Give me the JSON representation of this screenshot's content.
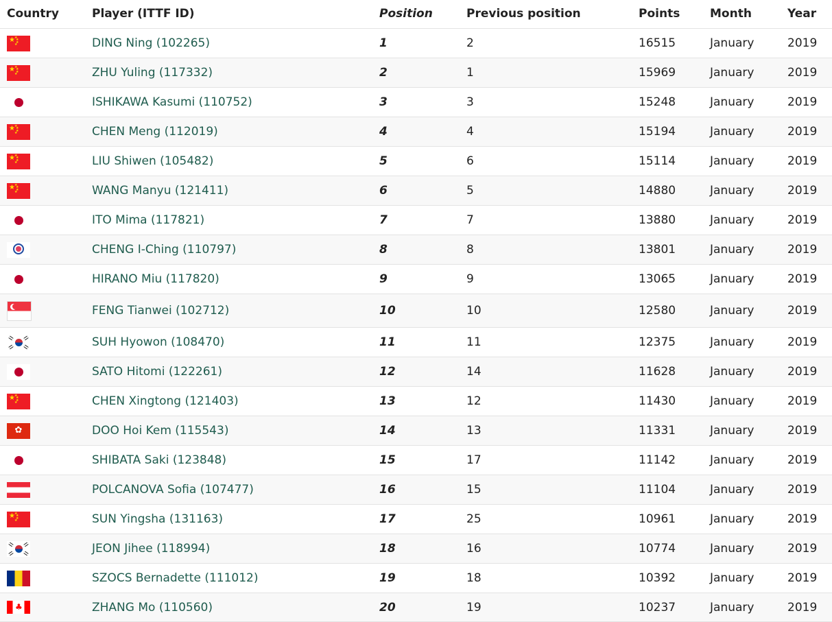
{
  "header": {
    "country": "Country",
    "player": "Player (ITTF ID)",
    "position": "Position",
    "previous_position": "Previous position",
    "points": "Points",
    "month": "Month",
    "year": "Year"
  },
  "colors": {
    "link": "#1f5c4e",
    "row_alt": "#f8f8f8",
    "border": "#e3e3e3"
  },
  "rows": [
    {
      "flag": "china-flag-icon",
      "player": "DING Ning (102265)",
      "position": "1",
      "previous": "2",
      "points": "16515",
      "month": "January",
      "year": "2019"
    },
    {
      "flag": "china-flag-icon",
      "player": "ZHU Yuling (117332)",
      "position": "2",
      "previous": "1",
      "points": "15969",
      "month": "January",
      "year": "2019"
    },
    {
      "flag": "japan-flag-icon",
      "player": "ISHIKAWA Kasumi (110752)",
      "position": "3",
      "previous": "3",
      "points": "15248",
      "month": "January",
      "year": "2019"
    },
    {
      "flag": "china-flag-icon",
      "player": "CHEN Meng (112019)",
      "position": "4",
      "previous": "4",
      "points": "15194",
      "month": "January",
      "year": "2019"
    },
    {
      "flag": "china-flag-icon",
      "player": "LIU Shiwen (105482)",
      "position": "5",
      "previous": "6",
      "points": "15114",
      "month": "January",
      "year": "2019"
    },
    {
      "flag": "china-flag-icon",
      "player": "WANG Manyu (121411)",
      "position": "6",
      "previous": "5",
      "points": "14880",
      "month": "January",
      "year": "2019"
    },
    {
      "flag": "japan-flag-icon",
      "player": "ITO Mima (117821)",
      "position": "7",
      "previous": "7",
      "points": "13880",
      "month": "January",
      "year": "2019"
    },
    {
      "flag": "chinese-taipei-flag-icon",
      "player": "CHENG I-Ching (110797)",
      "position": "8",
      "previous": "8",
      "points": "13801",
      "month": "January",
      "year": "2019"
    },
    {
      "flag": "japan-flag-icon",
      "player": "HIRANO Miu (117820)",
      "position": "9",
      "previous": "9",
      "points": "13065",
      "month": "January",
      "year": "2019"
    },
    {
      "flag": "singapore-flag-icon",
      "player": "FENG Tianwei (102712)",
      "position": "10",
      "previous": "10",
      "points": "12580",
      "month": "January",
      "year": "2019"
    },
    {
      "flag": "korea-flag-icon",
      "player": "SUH Hyowon (108470)",
      "position": "11",
      "previous": "11",
      "points": "12375",
      "month": "January",
      "year": "2019"
    },
    {
      "flag": "japan-flag-icon",
      "player": "SATO Hitomi (122261)",
      "position": "12",
      "previous": "14",
      "points": "11628",
      "month": "January",
      "year": "2019"
    },
    {
      "flag": "china-flag-icon",
      "player": "CHEN Xingtong (121403)",
      "position": "13",
      "previous": "12",
      "points": "11430",
      "month": "January",
      "year": "2019"
    },
    {
      "flag": "hong-kong-flag-icon",
      "player": "DOO Hoi Kem (115543)",
      "position": "14",
      "previous": "13",
      "points": "11331",
      "month": "January",
      "year": "2019"
    },
    {
      "flag": "japan-flag-icon",
      "player": "SHIBATA Saki (123848)",
      "position": "15",
      "previous": "17",
      "points": "11142",
      "month": "January",
      "year": "2019"
    },
    {
      "flag": "austria-flag-icon",
      "player": "POLCANOVA Sofia (107477)",
      "position": "16",
      "previous": "15",
      "points": "11104",
      "month": "January",
      "year": "2019"
    },
    {
      "flag": "china-flag-icon",
      "player": "SUN Yingsha (131163)",
      "position": "17",
      "previous": "25",
      "points": "10961",
      "month": "January",
      "year": "2019"
    },
    {
      "flag": "korea-flag-icon",
      "player": "JEON Jihee (118994)",
      "position": "18",
      "previous": "16",
      "points": "10774",
      "month": "January",
      "year": "2019"
    },
    {
      "flag": "romania-flag-icon",
      "player": "SZOCS Bernadette (111012)",
      "position": "19",
      "previous": "18",
      "points": "10392",
      "month": "January",
      "year": "2019"
    },
    {
      "flag": "canada-flag-icon",
      "player": "ZHANG Mo (110560)",
      "position": "20",
      "previous": "19",
      "points": "10237",
      "month": "January",
      "year": "2019"
    }
  ]
}
